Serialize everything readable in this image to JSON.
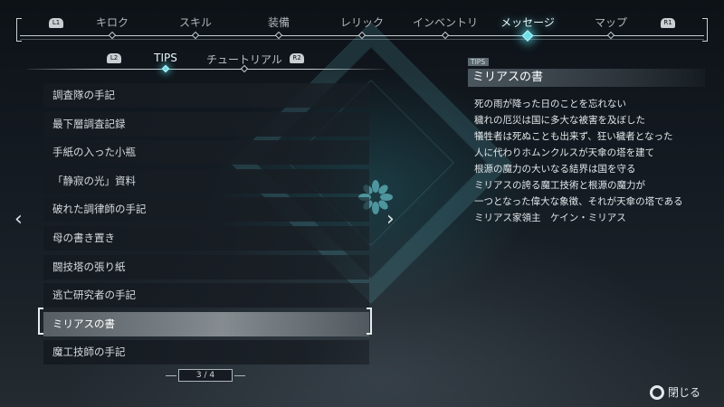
{
  "top_nav": {
    "left_button": "L1",
    "right_button": "R1",
    "tabs": [
      {
        "label": "キロク",
        "active": false
      },
      {
        "label": "スキル",
        "active": false
      },
      {
        "label": "装備",
        "active": false
      },
      {
        "label": "レリック",
        "active": false
      },
      {
        "label": "インベントリ",
        "active": false
      },
      {
        "label": "メッセージ",
        "active": true
      },
      {
        "label": "マップ",
        "active": false
      }
    ]
  },
  "sub_tabs": {
    "left_button": "L2",
    "right_button": "R2",
    "tabs": [
      {
        "label": "TIPS",
        "active": true
      },
      {
        "label": "チュートリアル",
        "active": false
      }
    ]
  },
  "list": {
    "items": [
      "調査隊の手記",
      "最下層調査記録",
      "手紙の入った小瓶",
      "「静寂の光」資料",
      "破れた調律師の手記",
      "母の書き置き",
      "闘技塔の張り紙",
      "逃亡研究者の手記",
      "ミリアスの書",
      "魔工技師の手記"
    ],
    "selected_index": 8,
    "arrow_left": "‹",
    "arrow_right": "›",
    "page": "3 / 4"
  },
  "detail": {
    "category": "TIPS",
    "title": "ミリアスの書",
    "lines": [
      "死の雨が降った日のことを忘れない",
      "穢れの厄災は国に多大な被害を及ぼした",
      "犠牲者は死ぬことも出来ず、狂い穢者となった",
      "人に代わりホムンクルスが天傘の塔を建て",
      "根源の魔力の大いなる結界は国を守る",
      "ミリアスの誇る魔工技術と根源の魔力が",
      "一つとなった偉大な象徴、それが天傘の塔である",
      "ミリアス家領主　ケイン・ミリアス"
    ]
  },
  "footer": {
    "close_label": "閉じる",
    "close_icon": "circle-button-icon"
  },
  "colors": {
    "accent": "#6fe0ea",
    "background": "#141b22",
    "selected_row": "#9aa0a4"
  }
}
